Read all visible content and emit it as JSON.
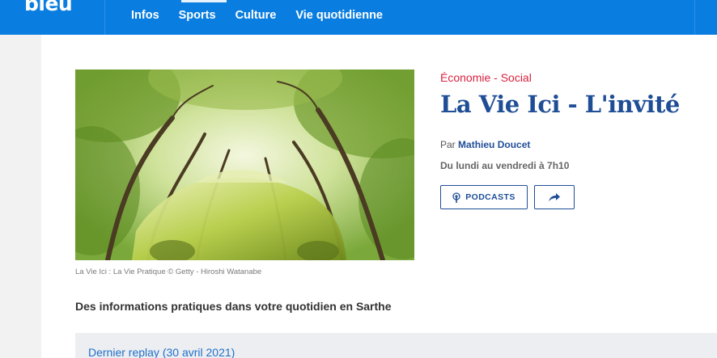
{
  "header": {
    "logo_text": "bleu",
    "nav": [
      "Infos",
      "Sports",
      "Culture",
      "Vie quotidienne"
    ]
  },
  "show": {
    "category": "Économie - Social",
    "title": "La Vie Ici - L'invité",
    "author_prefix": "Par",
    "author_name": "Mathieu Doucet",
    "schedule": "Du lundi au vendredi à 7h10",
    "podcasts_label": "PODCASTS",
    "image_caption": "La Vie Ici : La Vie Pratique © Getty - Hiroshi Watanabe",
    "description": "Des informations pratiques dans votre quotidien en Sarthe"
  },
  "replay": {
    "title": "Dernier replay (30 avril 2021)"
  },
  "colors": {
    "header_blue": "#0a7ee0",
    "title_blue": "#1f4e96",
    "category_red": "#d8213f"
  },
  "icons": [
    "podcast-icon",
    "share-arrow-icon"
  ]
}
